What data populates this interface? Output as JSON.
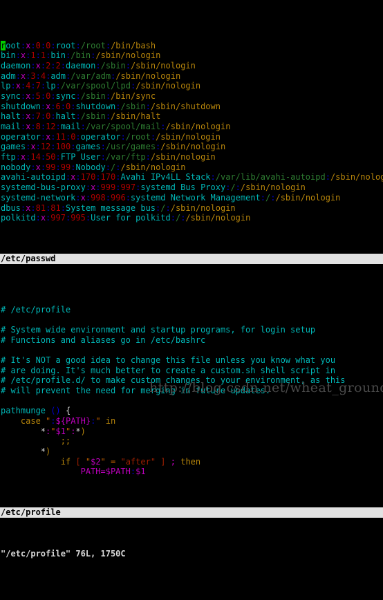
{
  "terminal": {
    "background": "#000000",
    "font_size_px": 12,
    "columns": 80,
    "application": "vim"
  },
  "window_top": {
    "file": "/etc/passwd",
    "status_label": "/etc/passwd",
    "cursor": {
      "line": 1,
      "column": 1,
      "char": "r"
    },
    "lines": [
      {
        "user": "root",
        "x": "x",
        "uid": "0",
        "gid": "0",
        "gecos": "root",
        "home": "/root",
        "shell": "/bin/bash"
      },
      {
        "user": "bin",
        "x": "x",
        "uid": "1",
        "gid": "1",
        "gecos": "bin",
        "home": "/bin",
        "shell": "/sbin/nologin"
      },
      {
        "user": "daemon",
        "x": "x",
        "uid": "2",
        "gid": "2",
        "gecos": "daemon",
        "home": "/sbin",
        "shell": "/sbin/nologin"
      },
      {
        "user": "adm",
        "x": "x",
        "uid": "3",
        "gid": "4",
        "gecos": "adm",
        "home": "/var/adm",
        "shell": "/sbin/nologin"
      },
      {
        "user": "lp",
        "x": "x",
        "uid": "4",
        "gid": "7",
        "gecos": "lp",
        "home": "/var/spool/lpd",
        "shell": "/sbin/nologin"
      },
      {
        "user": "sync",
        "x": "x",
        "uid": "5",
        "gid": "0",
        "gecos": "sync",
        "home": "/sbin",
        "shell": "/bin/sync"
      },
      {
        "user": "shutdown",
        "x": "x",
        "uid": "6",
        "gid": "0",
        "gecos": "shutdown",
        "home": "/sbin",
        "shell": "/sbin/shutdown"
      },
      {
        "user": "halt",
        "x": "x",
        "uid": "7",
        "gid": "0",
        "gecos": "halt",
        "home": "/sbin",
        "shell": "/sbin/halt"
      },
      {
        "user": "mail",
        "x": "x",
        "uid": "8",
        "gid": "12",
        "gecos": "mail",
        "home": "/var/spool/mail",
        "shell": "/sbin/nologin"
      },
      {
        "user": "operator",
        "x": "x",
        "uid": "11",
        "gid": "0",
        "gecos": "operator",
        "home": "/root",
        "shell": "/sbin/nologin"
      },
      {
        "user": "games",
        "x": "x",
        "uid": "12",
        "gid": "100",
        "gecos": "games",
        "home": "/usr/games",
        "shell": "/sbin/nologin"
      },
      {
        "user": "ftp",
        "x": "x",
        "uid": "14",
        "gid": "50",
        "gecos": "FTP User",
        "home": "/var/ftp",
        "shell": "/sbin/nologin"
      },
      {
        "user": "nobody",
        "x": "x",
        "uid": "99",
        "gid": "99",
        "gecos": "Nobody",
        "home": "/",
        "shell": "/sbin/nologin"
      },
      {
        "user": "avahi-autoipd",
        "x": "x",
        "uid": "170",
        "gid": "170",
        "gecos": "Avahi IPv4LL Stack",
        "home": "/var/lib/avahi-autoipd",
        "shell": "/sbin/nologin"
      },
      {
        "user": "systemd-bus-proxy",
        "x": "x",
        "uid": "999",
        "gid": "997",
        "gecos": "systemd Bus Proxy",
        "home": "/",
        "shell": "/sbin/nologin"
      },
      {
        "user": "systemd-network",
        "x": "x",
        "uid": "998",
        "gid": "996",
        "gecos": "systemd Network Management",
        "home": "/",
        "shell": "/sbin/nologin"
      },
      {
        "user": "dbus",
        "x": "x",
        "uid": "81",
        "gid": "81",
        "gecos": "System message bus",
        "home": "/",
        "shell": "/sbin/nologin"
      },
      {
        "user": "polkitd",
        "x": "x",
        "uid": "997",
        "gid": "995",
        "gecos": "User for polkitd",
        "home": "/",
        "shell": "/sbin/nologin"
      }
    ]
  },
  "window_bottom": {
    "file": "/etc/profile",
    "status_label": "/etc/profile",
    "comments": [
      "# /etc/profile",
      "",
      "# System wide environment and startup programs, for login setup",
      "# Functions and aliases go in /etc/bashrc",
      "",
      "# It's NOT a good idea to change this file unless you know what you",
      "# are doing. It's much better to create a custom.sh shell script in",
      "# /etc/profile.d/ to make custom changes to your environment, as this",
      "# will prevent the need for merging in future updates.",
      ""
    ],
    "code": {
      "func_name": "pathmunge",
      "func_parens": "()",
      "func_brace": "{",
      "case_kw": "case",
      "case_quote": "\"",
      "case_colon1": ":",
      "case_var": "${PATH}",
      "case_colon2": ":",
      "case_in": "in",
      "pat1_star": "*",
      "pat1_colon1": ":",
      "pat1_q1": "\"",
      "pat1_var": "$1",
      "pat1_q2": "\"",
      "pat1_colon2": ":",
      "pat1_star2": "*",
      "pat1_close": ")",
      "dsemi": ";;",
      "pat2_star": "*",
      "pat2_close": ")",
      "if_kw": "if",
      "bracket_open": "[",
      "if_q1": "\"",
      "if_var": "$2",
      "if_q2": "\"",
      "if_eq": "=",
      "if_after": "\"after\"",
      "bracket_close": "]",
      "semi": ";",
      "then_kw": "then",
      "assign_name": "PATH",
      "assign_eq": "=",
      "assign_var1": "$PATH",
      "assign_colon": ":",
      "assign_var2": "$1"
    }
  },
  "command_line": {
    "text": "\"/etc/profile\" 76L, 1750C",
    "filename": "\"/etc/profile\"",
    "lines_count": "76L",
    "chars_count": "1750C"
  },
  "watermark": {
    "text": "http://blog.csdn.net/wheat_ground"
  },
  "colors": {
    "background": "#000000",
    "username": "#00b7b7",
    "password_x": "#c000c0",
    "uid_gid": "#b00000",
    "home": "#2e7d32",
    "shell": "#b8860b",
    "separator": "#0000d0",
    "comment": "#00b7b7",
    "keyword": "#b8860b",
    "string": "#c06000",
    "variable": "#c000c0",
    "statusbar_bg": "#e2e2e2",
    "statusbar_fg": "#000000",
    "cursor_bg": "#00cc00",
    "watermark": "#4a4a4a"
  }
}
